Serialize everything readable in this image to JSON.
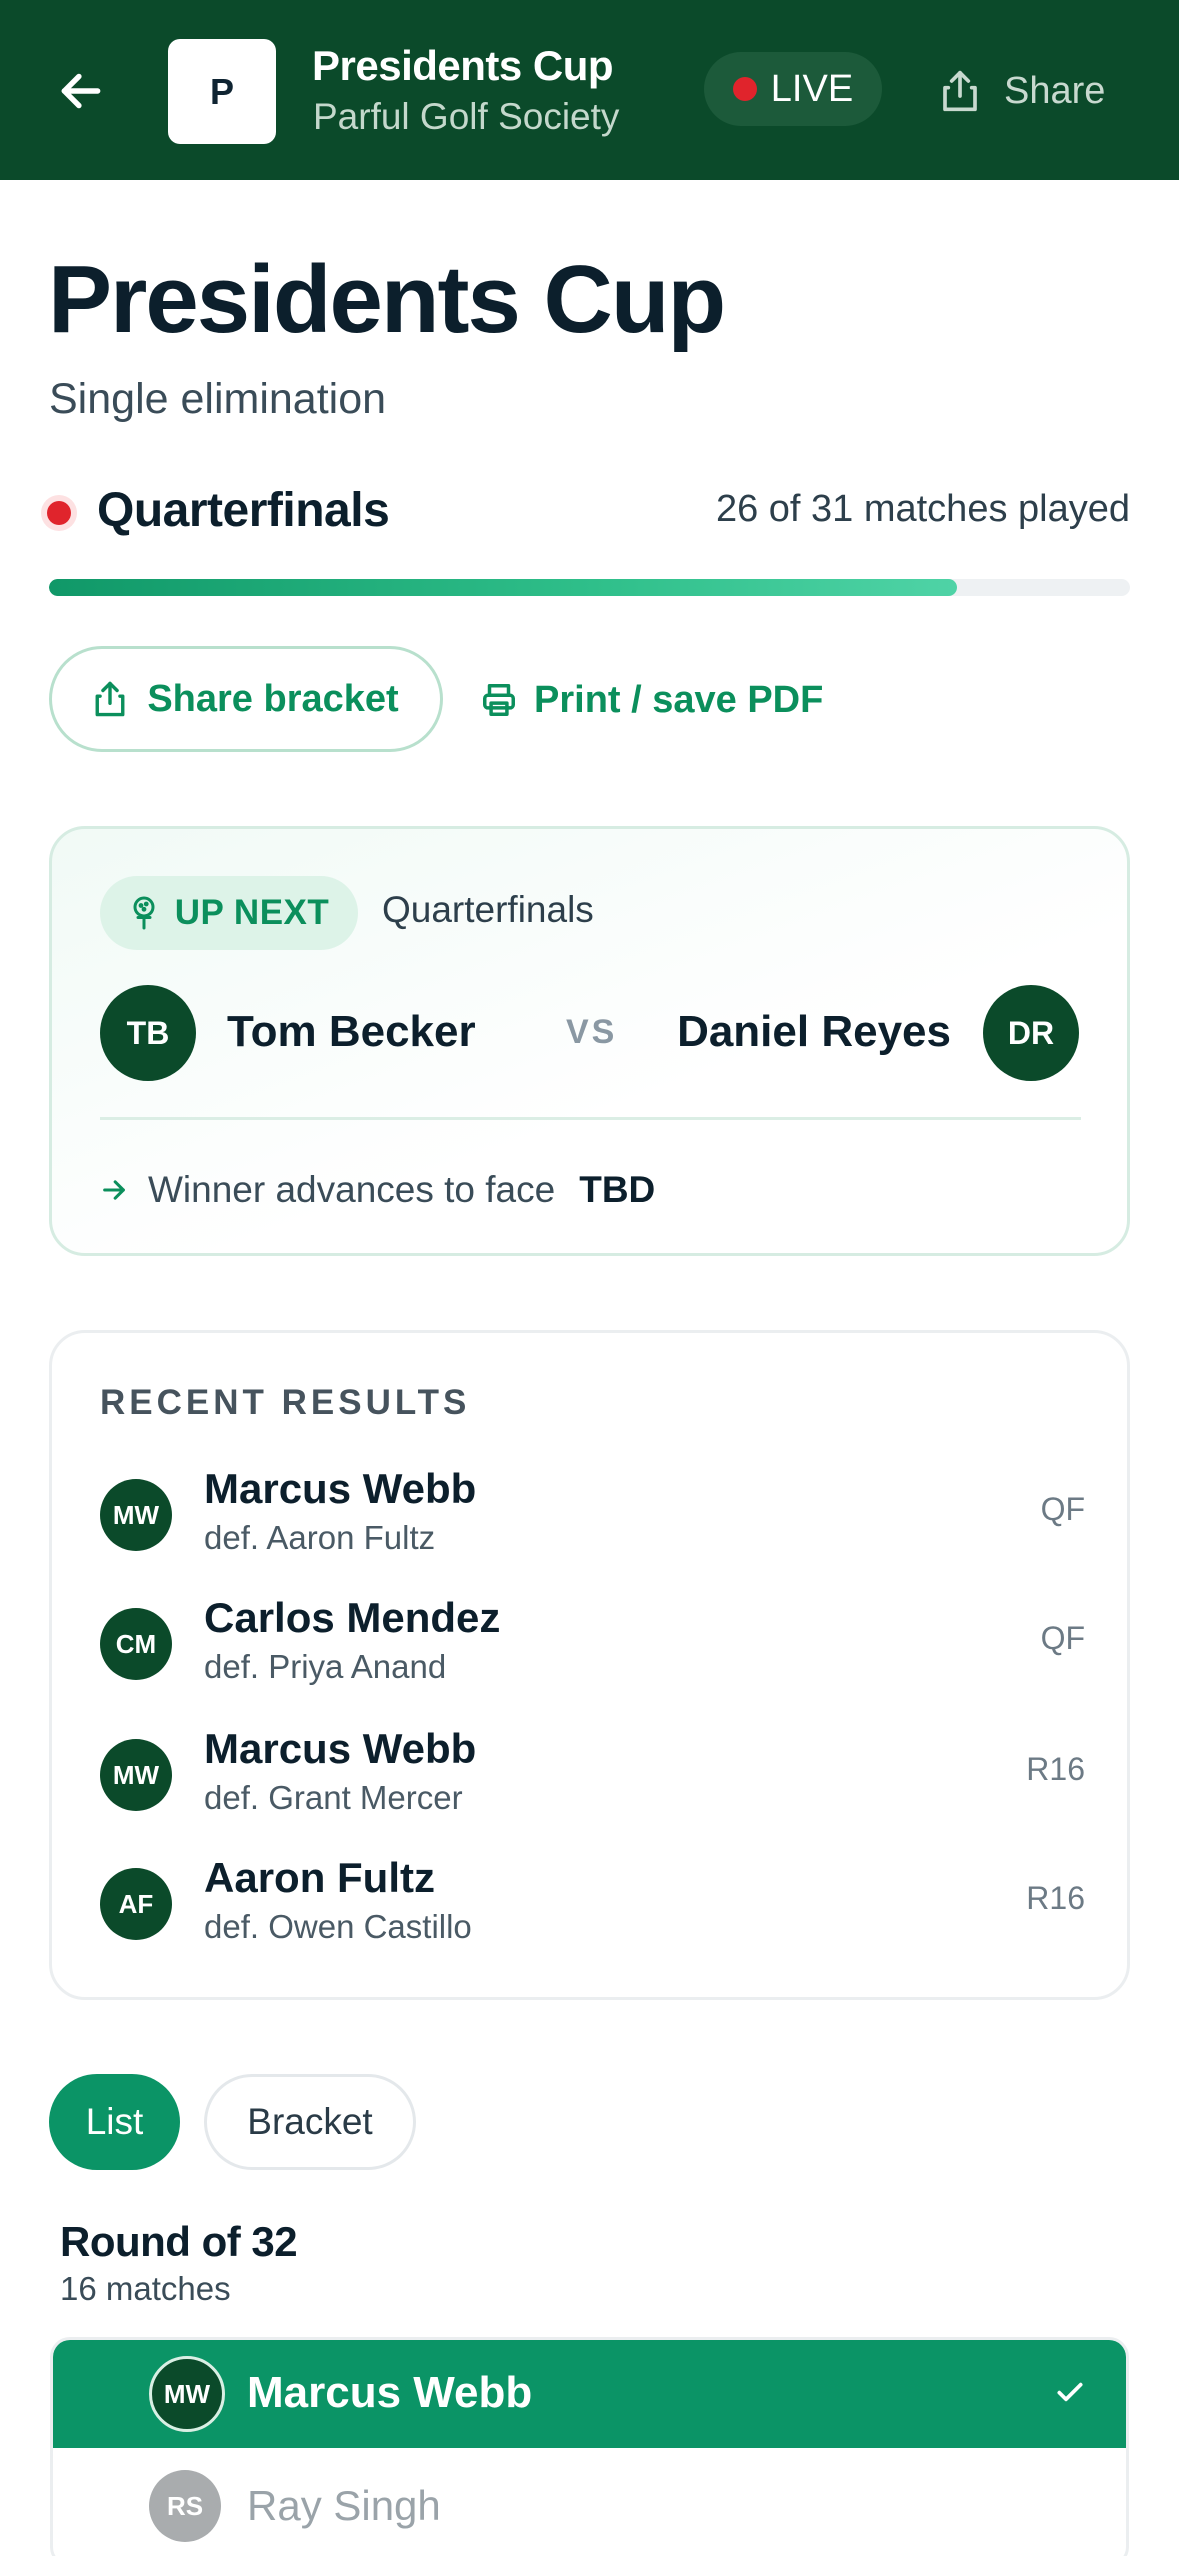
{
  "header": {
    "logo_letter": "P",
    "title": "Presidents Cup",
    "subtitle": "Parful Golf Society",
    "live_label": "LIVE",
    "share_label": "Share"
  },
  "tournament": {
    "title": "Presidents Cup",
    "format": "Single elimination",
    "current_round": "Quarterfinals",
    "progress_text": "26 of 31 matches played",
    "progress_fraction": 0.84
  },
  "actions": {
    "share_bracket": "Share bracket",
    "print_pdf": "Print / save PDF"
  },
  "up_next": {
    "badge": "UP NEXT",
    "round": "Quarterfinals",
    "player1": {
      "initials": "TB",
      "name": "Tom Becker"
    },
    "vs": "VS",
    "player2": {
      "initials": "DR",
      "name": "Daniel Reyes"
    },
    "advance_text": "Winner advances to face",
    "advance_opponent": "TBD"
  },
  "recent_results": {
    "heading": "RECENT RESULTS",
    "items": [
      {
        "initials": "MW",
        "winner": "Marcus Webb",
        "loser": "def. Aaron Fultz",
        "round": "QF"
      },
      {
        "initials": "CM",
        "winner": "Carlos Mendez",
        "loser": "def. Priya Anand",
        "round": "QF"
      },
      {
        "initials": "MW",
        "winner": "Marcus Webb",
        "loser": "def. Grant Mercer",
        "round": "R16"
      },
      {
        "initials": "AF",
        "winner": "Aaron Fultz",
        "loser": "def. Owen Castillo",
        "round": "R16"
      }
    ]
  },
  "view_toggle": {
    "list": "List",
    "bracket": "Bracket",
    "selected": "List"
  },
  "round_section": {
    "title": "Round of 32",
    "subtitle": "16 matches",
    "match": {
      "winner": {
        "initials": "MW",
        "name": "Marcus Webb"
      },
      "loser": {
        "initials": "RS",
        "name": "Ray Singh"
      }
    }
  },
  "colors": {
    "header_bg": "#0b4a2a",
    "accent": "#0b9466",
    "live_red": "#e0242c"
  }
}
